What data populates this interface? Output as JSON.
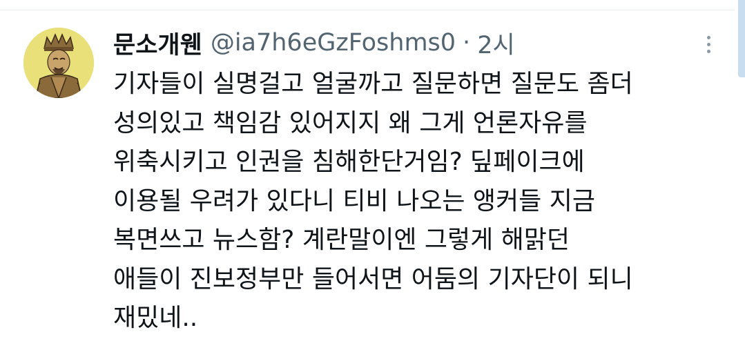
{
  "tweet": {
    "display_name": "문소개웬",
    "handle": "@ia7h6eGzFoshms0",
    "separator": "·",
    "time": "2시",
    "avatar_icon": "portrait-avatar-icon",
    "more_icon": "more-options-icon",
    "body_lines": [
      "기자들이 실명걸고 얼굴까고 질문하면 질문도 좀더",
      "성의있고 책임감 있어지지 왜 그게 언론자유를",
      "위축시키고 인권을 침해한단거임? 딮페이크에",
      "이용될 우려가 있다니 티비 나오는 앵커들 지금",
      "복면쓰고 뉴스함? 계란말이엔 그렇게 해맑던",
      "애들이 진보정부만 들어서면 어둠의 기자단이 되니",
      "재밌네.."
    ]
  },
  "colors": {
    "text": "#0f1419",
    "secondary": "#536471",
    "avatar_bg": "#e9e07a",
    "divider": "#e6ecf0",
    "scrollbar": "#c8ddf0"
  }
}
